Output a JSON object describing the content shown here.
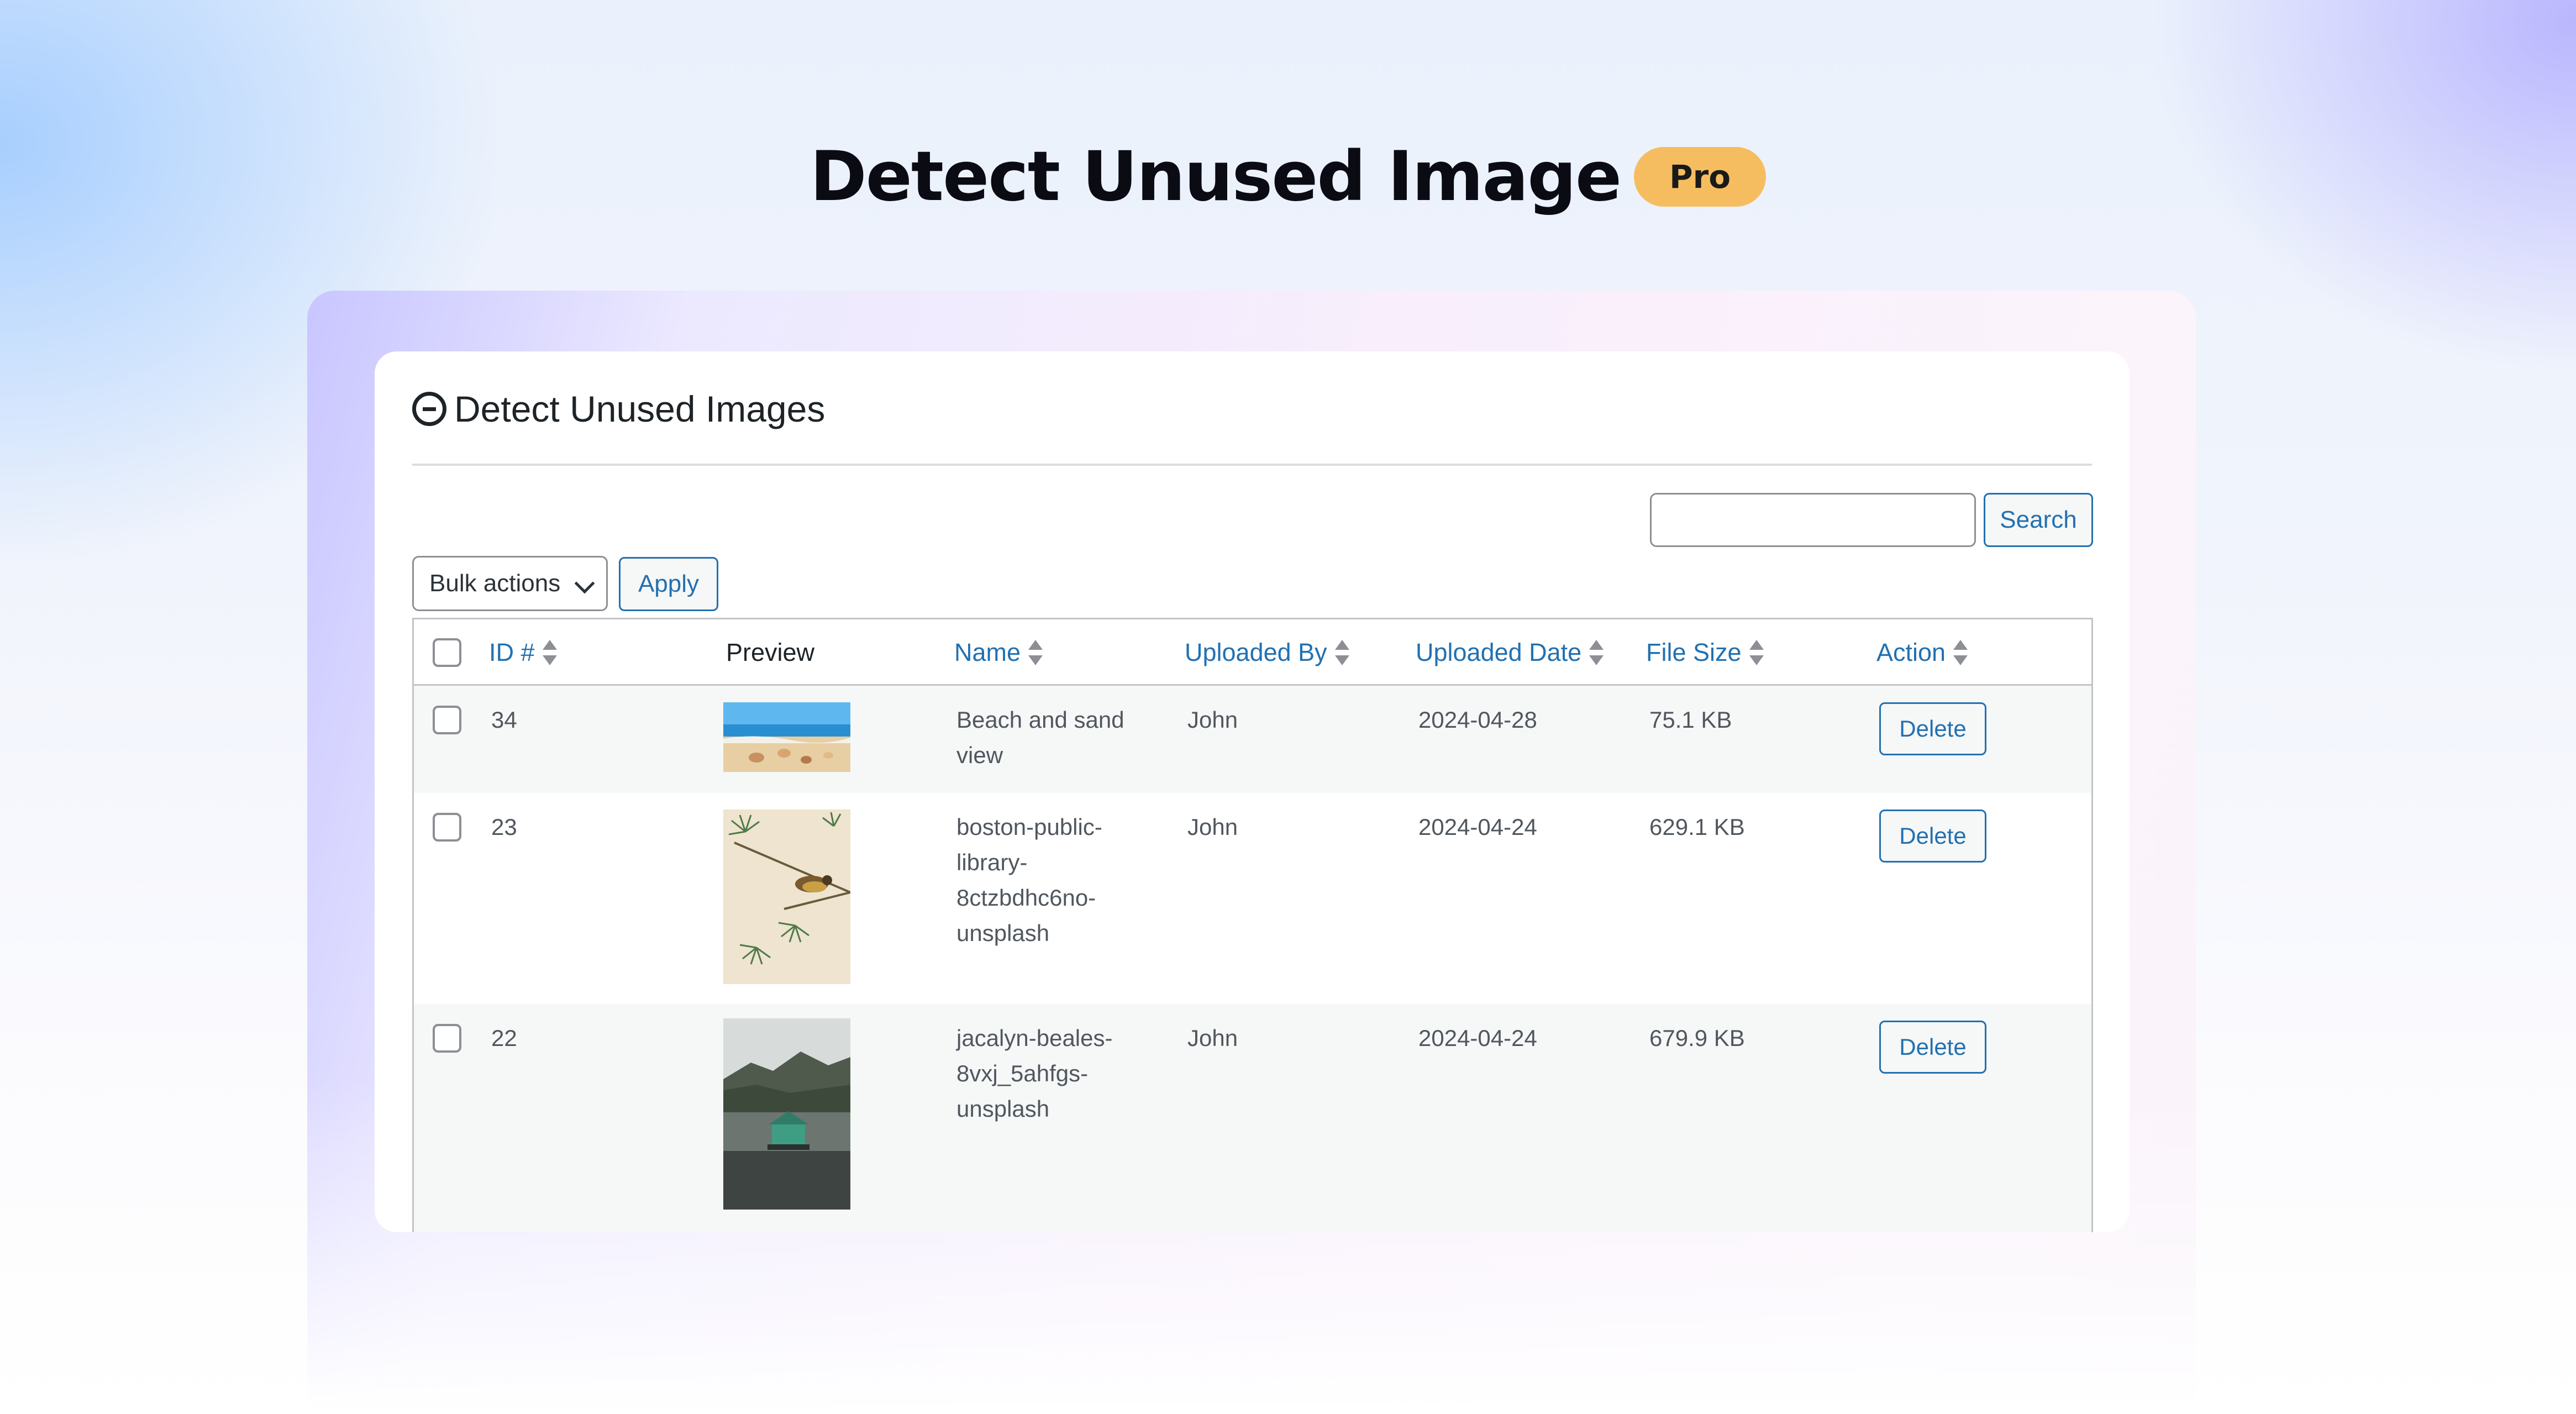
{
  "hero": {
    "title": "Detect Unused Image",
    "badge": "Pro"
  },
  "panel": {
    "title": "Detect Unused Images"
  },
  "search": {
    "placeholder": "",
    "value": "",
    "button_label": "Search"
  },
  "bulk": {
    "selected": "Bulk actions",
    "apply_label": "Apply"
  },
  "table": {
    "headers": {
      "id": "ID #",
      "preview": "Preview",
      "name": "Name",
      "uploaded_by": "Uploaded By",
      "uploaded_date": "Uploaded Date",
      "file_size": "File Size",
      "action": "Action"
    },
    "rows": [
      {
        "id": "34",
        "name": "Beach and sand view",
        "uploaded_by": "John",
        "uploaded_date": "2024-04-28",
        "file_size": "75.1 KB",
        "action": "Delete",
        "preview_icon": "beach-photo"
      },
      {
        "id": "23",
        "name": "boston-public-library-8ctzbdhc6no-unsplash",
        "uploaded_by": "John",
        "uploaded_date": "2024-04-24",
        "file_size": "629.1 KB",
        "action": "Delete",
        "preview_icon": "bird-on-branch-photo"
      },
      {
        "id": "22",
        "name": "jacalyn-beales-8vxj_5ahfgs-unsplash",
        "uploaded_by": "John",
        "uploaded_date": "2024-04-24",
        "file_size": "679.9 KB",
        "action": "Delete",
        "preview_icon": "lake-house-photo"
      }
    ]
  },
  "colors": {
    "accent": "#2271b1",
    "badge": "#f6bd60",
    "title": "#0b0b14"
  }
}
